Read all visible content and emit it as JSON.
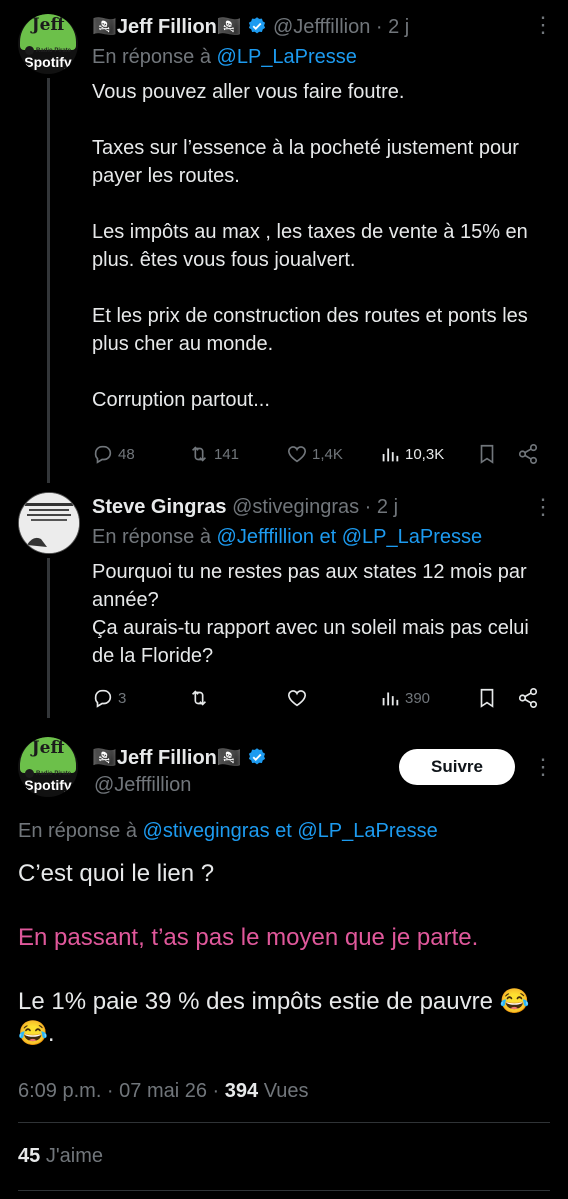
{
  "tweet1": {
    "name": "🏴‍☠️Jeff Fillion🏴‍☠️",
    "handle": "@Jefffillion",
    "time": "· 2 j",
    "reply_prefix": "En réponse à",
    "reply_to": "@LP_LaPresse",
    "paragraphs": [
      "Vous pouvez aller vous faire foutre.",
      "Taxes sur l’essence à la pocheté justement pour payer les routes.",
      "Les impôts au max , les taxes de vente à 15% en plus. êtes vous fous joualvert.",
      "Et les prix de construction des routes et ponts les plus cher au monde.",
      "Corruption partout..."
    ],
    "replies": "48",
    "reposts": "141",
    "likes": "1,4K",
    "views": "10,3K"
  },
  "avatar_jeff": {
    "title": "Jeff",
    "subtitle": "Radio Pirate",
    "platform": "Spotify"
  },
  "tweet2": {
    "name": "Steve Gingras",
    "handle": "@stivegingras",
    "time": "· 2 j",
    "reply_prefix": "En réponse à",
    "reply_to": "@Jefffillion et @LP_LaPresse",
    "lines": [
      "Pourquoi tu ne restes pas aux states 12 mois par année?",
      "Ça aurais-tu rapport avec un soleil mais pas celui de la Floride?"
    ],
    "replies": "3",
    "views": "390"
  },
  "tweet3": {
    "name": "🏴‍☠️Jeff Fillion🏴‍☠️",
    "handle": "@Jefffillion",
    "follow_label": "Suivre",
    "reply_prefix": "En réponse à",
    "reply_to": "@stivegingras et @LP_LaPresse",
    "paragraph1": "C’est quoi le lien ?",
    "paragraph2": "En passant, t’as pas le moyen que je parte.",
    "paragraph3": "Le 1% paie 39 % des impôts estie de pauvre 😂😂.",
    "time": "6:09 p.m. · 07 mai 26 ·",
    "views_count": "394",
    "views_label": "Vues",
    "likes_count": "45",
    "likes_label": "J'aime"
  },
  "colors": {
    "background": "#000000",
    "text": "#e7e9ea",
    "muted": "#71767b",
    "link": "#1d9bf0",
    "highlight": "#e0589b",
    "verified": "#1d9bf0",
    "avatar_green": "#6cc04a"
  }
}
